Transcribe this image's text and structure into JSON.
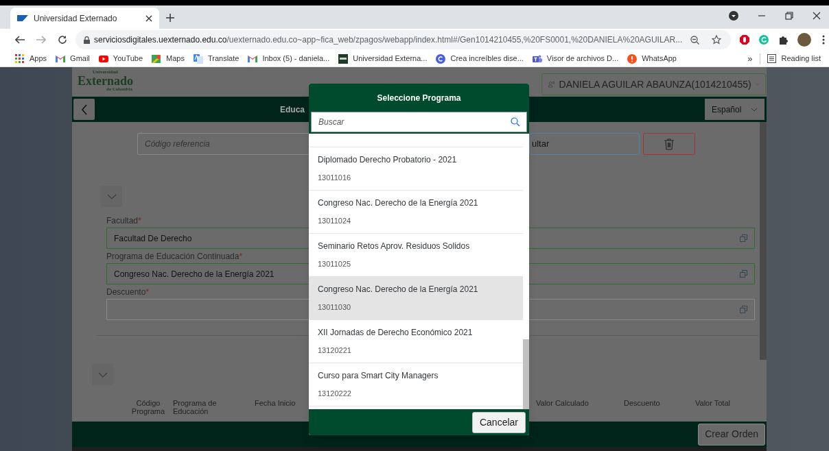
{
  "browser": {
    "tabs": [
      {
        "title": "Universidad Externado",
        "selected": true
      }
    ],
    "url_host": "serviciosdigitales.uexternado.edu.co",
    "url_path": "/uexternado.edu.co~app~fica_web/zpagos/webapp/index.html#/Gen1014210455,%20FS0001,%20DANIELA%20AGUILAR...",
    "bookmarks": [
      {
        "label": "Apps",
        "kind": "apps"
      },
      {
        "label": "Gmail",
        "kind": "gmail"
      },
      {
        "label": "YouTube",
        "kind": "youtube"
      },
      {
        "label": "Maps",
        "kind": "maps"
      },
      {
        "label": "Translate",
        "kind": "translate"
      },
      {
        "label": "Inbox (5) - daniela...",
        "kind": "gmail"
      },
      {
        "label": "Universidad Externa...",
        "kind": "square"
      },
      {
        "label": "Crea increíbles dise...",
        "kind": "circle"
      },
      {
        "label": "Visor de archivos D...",
        "kind": "teams"
      },
      {
        "label": "WhatsApp",
        "kind": "alert"
      }
    ],
    "more_bookmarks": "»",
    "reading_list": "Reading list"
  },
  "app": {
    "logo": {
      "top": "Universidad",
      "main": "Externado",
      "bottom": "de Colombia"
    },
    "user": "DANIELA AGUILAR ABAUNZA(1014210455)",
    "title": "Educa",
    "language": "Español",
    "reference_placeholder": "Código referencia",
    "consult_button": "ultar",
    "fields": [
      {
        "label": "Facultad",
        "required_mark": "*",
        "value": "Facultad De Derecho",
        "valid": true
      },
      {
        "label": "Programa de Educación Continuada",
        "required_mark": "*",
        "value": "Congreso Nac. Derecho de la Energía 2021",
        "valid": true
      },
      {
        "label": "Descuento",
        "required_mark": "*",
        "valid": false
      }
    ],
    "table": {
      "columns": [
        "Código Programa",
        "Programa de Educación",
        "Fecha Inicio",
        "Valor Calculado",
        "Descuento",
        "Valor Total"
      ]
    },
    "create_button": "Crear Orden"
  },
  "dialog": {
    "title": "Seleccione Programa",
    "search": {
      "placeholder": "Buscar"
    },
    "items": [
      {
        "name": "Diplomado Derecho Probatorio - 2021",
        "code": "13011016",
        "selected": false
      },
      {
        "name": "Congreso Nac. Derecho de la Energía 2021",
        "code": "13011024",
        "selected": false
      },
      {
        "name": "Seminario Retos Aprov. Residuos Solidos",
        "code": "13011025",
        "selected": false
      },
      {
        "name": "Congreso Nac. Derecho de la Energía 2021",
        "code": "13011030",
        "selected": true
      },
      {
        "name": "XII Jornadas de Derecho Económico 2021",
        "code": "13120221",
        "selected": false
      },
      {
        "name": "Curso para Smart City Managers",
        "code": "13120222",
        "selected": false
      }
    ],
    "cancel_button": "Cancelar"
  }
}
